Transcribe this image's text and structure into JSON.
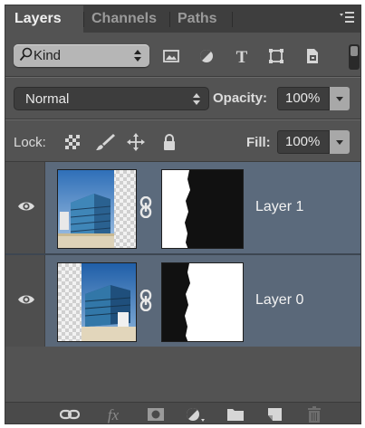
{
  "tabs": [
    {
      "label": "Layers",
      "active": true
    },
    {
      "label": "Channels",
      "active": false
    },
    {
      "label": "Paths",
      "active": false
    }
  ],
  "panel_menu_icon": "panel-menu-icon",
  "filter": {
    "kind_label": "Kind",
    "filter_icons": [
      "image-filter-icon",
      "adjustment-filter-icon",
      "type-filter-icon",
      "shape-filter-icon",
      "smart-object-filter-icon"
    ]
  },
  "blend": {
    "mode": "Normal",
    "opacity_label": "Opacity:",
    "opacity_value": "100%"
  },
  "lock": {
    "label": "Lock:",
    "icons": [
      "lock-transparent-pixels-icon",
      "lock-image-pixels-icon",
      "lock-position-icon",
      "lock-all-icon"
    ],
    "fill_label": "Fill:",
    "fill_value": "100%"
  },
  "layers": [
    {
      "name": "Layer 1",
      "visible": true,
      "has_mask": true,
      "mask_style": "white-left-black-right"
    },
    {
      "name": "Layer 0",
      "visible": true,
      "has_mask": true,
      "mask_style": "black-left-white-right"
    }
  ],
  "bottom_icons": [
    "link-layers-icon",
    "fx-icon",
    "add-mask-icon",
    "adjustment-layer-icon",
    "new-group-icon",
    "new-layer-icon",
    "delete-layer-icon"
  ],
  "colors": {
    "panel_bg": "#535353",
    "selected_layer_bg": "#5b6a7c",
    "tab_bar_bg": "#3e3e3e"
  }
}
